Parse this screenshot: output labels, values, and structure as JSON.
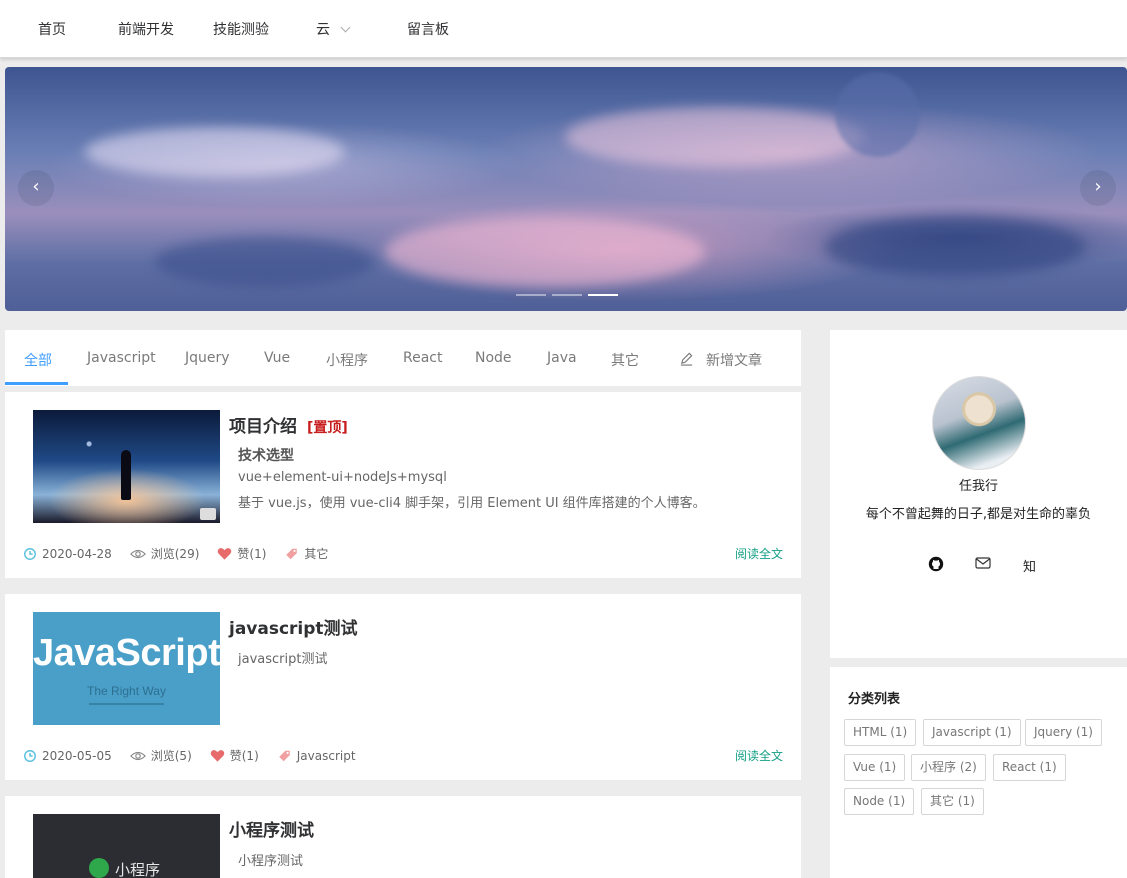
{
  "nav": {
    "items": [
      "首页",
      "前端开发",
      "技能测验",
      "云",
      "留言板"
    ]
  },
  "banner": {
    "prev_icon": "chevron-left-icon",
    "next_icon": "chevron-right-icon",
    "indicator_count": 3,
    "active_indicator": 2,
    "arrow_prev": "‹",
    "arrow_next": "›"
  },
  "tabs": {
    "items": [
      "全部",
      "Javascript",
      "Jquery",
      "Vue",
      "小程序",
      "React",
      "Node",
      "Java",
      "其它"
    ],
    "active": "全部",
    "new_article": "新增文章",
    "accent": "#409eff"
  },
  "articles": [
    {
      "title": "项目介绍",
      "pinned_label": "[置顶]",
      "subheading": "技术选型",
      "lines": [
        "vue+element-ui+nodeJs+mysql",
        "基于 vue.js，使用 vue-cli4 脚手架，引用 Element UI 组件库搭建的个人博客。"
      ],
      "date": "2020-04-28",
      "views": "浏览(29)",
      "likes": "赞(1)",
      "tag": "其它",
      "read_more": "阅读全文"
    },
    {
      "title": "javascript测试",
      "lines": [
        "javascript测试"
      ],
      "thumb_text": "JavaScript",
      "thumb_sub": "The Right Way",
      "date": "2020-05-05",
      "views": "浏览(5)",
      "likes": "赞(1)",
      "tag": "Javascript",
      "read_more": "阅读全文"
    },
    {
      "title": "小程序测试",
      "lines": [
        "小程序测试"
      ],
      "thumb_text": "小程序"
    }
  ],
  "profile": {
    "name": "任我行",
    "motto": "每个不曾起舞的日子,都是对生命的辜负",
    "social": [
      "github-icon",
      "mail-icon",
      "zhihu-icon"
    ],
    "zhihu_label": "知"
  },
  "categories": {
    "title": "分类列表",
    "tags": [
      "HTML (1)",
      "Javascript (1)",
      "Jquery (1)",
      "Vue (1)",
      "小程序 (2)",
      "React (1)",
      "Node (1)",
      "其它 (1)"
    ]
  },
  "colors": {
    "readmore": "#16a085",
    "pin": "#c81d1d",
    "heart": "#e86b6b",
    "clock": "#5bc0de"
  }
}
